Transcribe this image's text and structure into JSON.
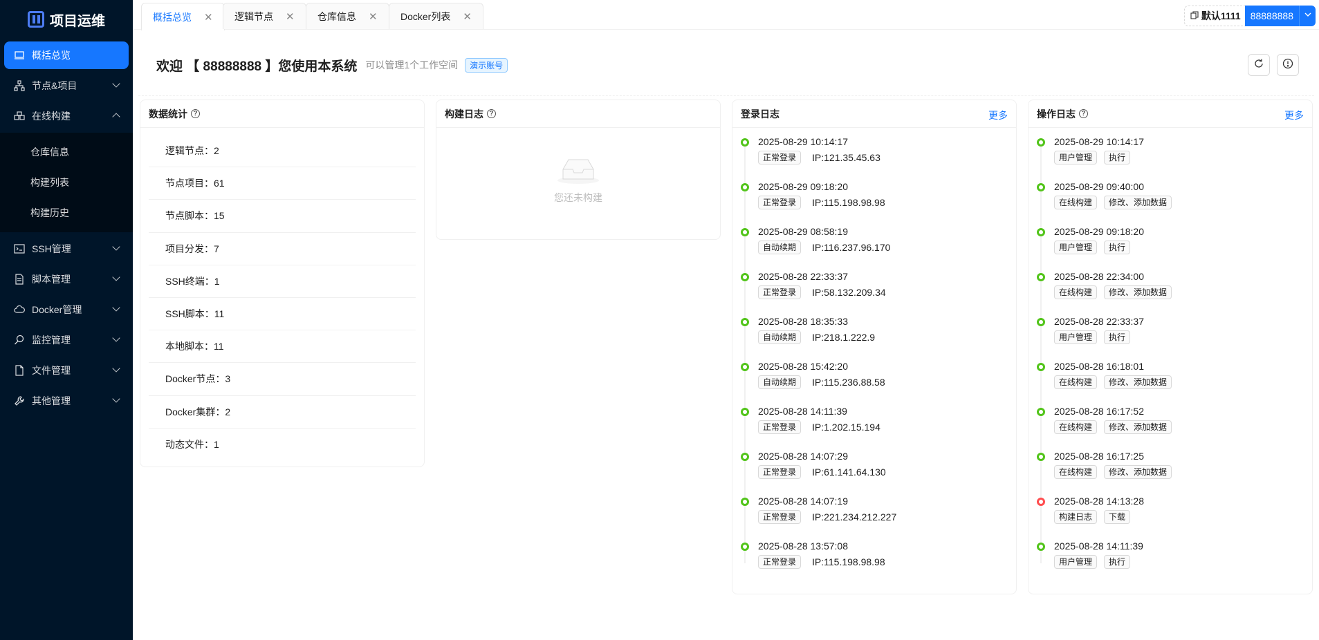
{
  "app": {
    "title": "项目运维"
  },
  "sidebar": {
    "items": [
      {
        "label": "概括总览",
        "icon": "laptop-icon",
        "active": true
      },
      {
        "label": "节点&项目",
        "icon": "cluster-icon"
      },
      {
        "label": "在线构建",
        "icon": "build-icon",
        "expanded": true
      },
      {
        "label": "SSH管理",
        "icon": "terminal-icon"
      },
      {
        "label": "脚本管理",
        "icon": "file-text-icon"
      },
      {
        "label": "Docker管理",
        "icon": "cloud-icon"
      },
      {
        "label": "监控管理",
        "icon": "monitor-search-icon"
      },
      {
        "label": "文件管理",
        "icon": "file-icon"
      },
      {
        "label": "其他管理",
        "icon": "tool-icon"
      }
    ],
    "submenu": [
      "仓库信息",
      "构建列表",
      "构建历史"
    ]
  },
  "tabs": [
    {
      "label": "概括总览",
      "active": true
    },
    {
      "label": "逻辑节点"
    },
    {
      "label": "仓库信息"
    },
    {
      "label": "Docker列表"
    }
  ],
  "user": {
    "workspace": "默认1111",
    "name": "88888888"
  },
  "header": {
    "welcome": "欢迎 【 88888888 】您使用本系统",
    "subtitle": "可以管理1个工作空间",
    "demo_tag": "演示账号"
  },
  "stats": {
    "title": "数据统计",
    "items": [
      "逻辑节点：2",
      "节点项目：61",
      "节点脚本：15",
      "项目分发：7",
      "SSH终端：1",
      "SSH脚本：11",
      "本地脚本：11",
      "Docker节点：3",
      "Docker集群：2",
      "动态文件：1"
    ]
  },
  "build_log": {
    "title": "构建日志",
    "empty": "您还未构建"
  },
  "login_log": {
    "title": "登录日志",
    "more": "更多",
    "entries": [
      {
        "time": "2025-08-29 10:14:17",
        "type": "正常登录",
        "ip": "IP:121.35.45.63"
      },
      {
        "time": "2025-08-29 09:18:20",
        "type": "正常登录",
        "ip": "IP:115.198.98.98"
      },
      {
        "time": "2025-08-29 08:58:19",
        "type": "自动续期",
        "ip": "IP:116.237.96.170"
      },
      {
        "time": "2025-08-28 22:33:37",
        "type": "正常登录",
        "ip": "IP:58.132.209.34"
      },
      {
        "time": "2025-08-28 18:35:33",
        "type": "自动续期",
        "ip": "IP:218.1.222.9"
      },
      {
        "time": "2025-08-28 15:42:20",
        "type": "自动续期",
        "ip": "IP:115.236.88.58"
      },
      {
        "time": "2025-08-28 14:11:39",
        "type": "正常登录",
        "ip": "IP:1.202.15.194"
      },
      {
        "time": "2025-08-28 14:07:29",
        "type": "正常登录",
        "ip": "IP:61.141.64.130"
      },
      {
        "time": "2025-08-28 14:07:19",
        "type": "正常登录",
        "ip": "IP:221.234.212.227"
      },
      {
        "time": "2025-08-28 13:57:08",
        "type": "正常登录",
        "ip": "IP:115.198.98.98"
      }
    ]
  },
  "op_log": {
    "title": "操作日志",
    "more": "更多",
    "entries": [
      {
        "time": "2025-08-29 10:14:17",
        "module": "用户管理",
        "action": "执行",
        "status": "success"
      },
      {
        "time": "2025-08-29 09:40:00",
        "module": "在线构建",
        "action": "修改、添加数据",
        "status": "success"
      },
      {
        "time": "2025-08-29 09:18:20",
        "module": "用户管理",
        "action": "执行",
        "status": "success"
      },
      {
        "time": "2025-08-28 22:34:00",
        "module": "在线构建",
        "action": "修改、添加数据",
        "status": "success"
      },
      {
        "time": "2025-08-28 22:33:37",
        "module": "用户管理",
        "action": "执行",
        "status": "success"
      },
      {
        "time": "2025-08-28 16:18:01",
        "module": "在线构建",
        "action": "修改、添加数据",
        "status": "success"
      },
      {
        "time": "2025-08-28 16:17:52",
        "module": "在线构建",
        "action": "修改、添加数据",
        "status": "success"
      },
      {
        "time": "2025-08-28 16:17:25",
        "module": "在线构建",
        "action": "修改、添加数据",
        "status": "success"
      },
      {
        "time": "2025-08-28 14:13:28",
        "module": "构建日志",
        "action": "下载",
        "status": "error"
      },
      {
        "time": "2025-08-28 14:11:39",
        "module": "用户管理",
        "action": "执行",
        "status": "success"
      }
    ]
  },
  "colors": {
    "sidebar_bg": "#001529",
    "accent": "#1677ff",
    "success": "#52c41a",
    "error": "#ff4d4f"
  }
}
